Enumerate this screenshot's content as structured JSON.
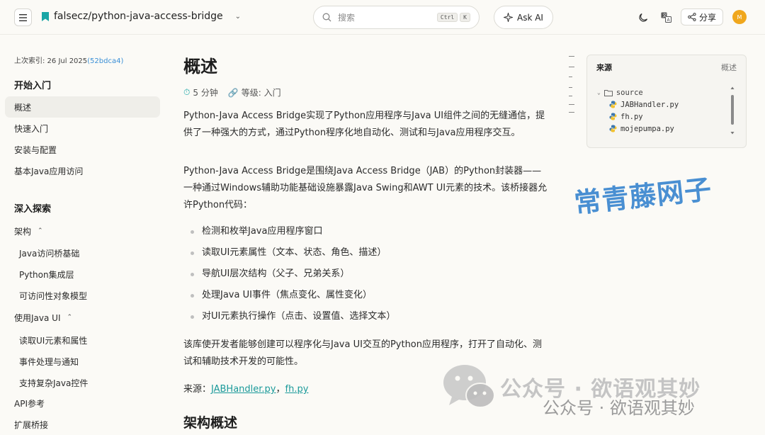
{
  "header": {
    "repo_name": "falsecz/python-java-access-bridge",
    "search_placeholder": "搜索",
    "kbd_ctrl": "Ctrl",
    "kbd_k": "K",
    "ask_ai": "Ask AI",
    "share": "分享",
    "avatar_initial": "M"
  },
  "sidebar": {
    "indexed_prefix": "上次索引: 26 Jul 2025",
    "indexed_commit": "(52bdca4)",
    "section1": "开始入门",
    "items1": [
      "概述",
      "快速入门",
      "安装与配置",
      "基本Java应用访问"
    ],
    "section2": "深入探索",
    "arch": "架构",
    "arch_children": [
      "Java访问桥基础",
      "Python集成层",
      "可访问性对象模型"
    ],
    "use_java_ui": "使用Java UI",
    "use_children": [
      "读取UI元素和属性",
      "事件处理与通知",
      "支持复杂Java控件"
    ],
    "api_ref": "API参考",
    "ext_bridge": "扩展桥接"
  },
  "main": {
    "title": "概述",
    "read_time": "5 分钟",
    "level": "等级: 入门",
    "p1": "Python-Java Access Bridge实现了Python应用程序与Java UI组件之间的无缝通信，提供了一种强大的方式，通过Python程序化地自动化、测试和与Java应用程序交互。",
    "p2": "Python-Java Access Bridge是围绕Java Access Bridge（JAB）的Python封装器——一种通过Windows辅助功能基础设施暴露Java Swing和AWT UI元素的技术。该桥接器允许Python代码：",
    "bullets": [
      "检测和枚举Java应用程序窗口",
      "读取UI元素属性（文本、状态、角色、描述）",
      "导航UI层次结构（父子、兄弟关系）",
      "处理Java UI事件（焦点变化、属性变化）",
      "对UI元素执行操作（点击、设置值、选择文本）"
    ],
    "p3": "该库使开发者能够创建可以程序化与Java UI交互的Python应用程序，打开了自动化、测试和辅助技术开发的可能性。",
    "source_label": "来源：",
    "source_link1": "JABHandler.py",
    "source_sep": "，",
    "source_link2": "fh.py",
    "h2": "架构概述"
  },
  "source_panel": {
    "title": "来源",
    "right_label": "概述",
    "folder": "source",
    "files": [
      "JABHandler.py",
      "fh.py",
      "mojepumpa.py"
    ]
  },
  "watermarks": {
    "blue": "常青藤网子",
    "gray_big": "公众号 · 欲语观其妙",
    "gray_small": "公众号 · 欲语观其妙"
  },
  "colors": {
    "accent_teal": "#1a9a9a",
    "link_blue": "#3a8fd6",
    "avatar": "#f0a71d"
  }
}
